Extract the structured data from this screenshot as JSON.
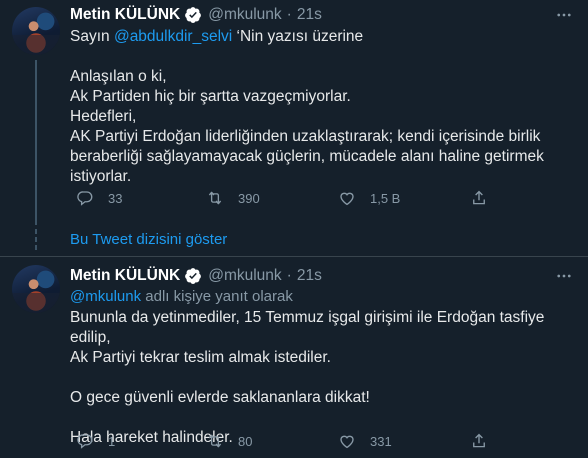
{
  "tweets": [
    {
      "author_name": "Metin KÜLÜNK",
      "handle": "@mkulunk",
      "separator": "·",
      "time": "21s",
      "text_lines": [
        {
          "before": "Sayın ",
          "mention": "@abdulkdir_selvi",
          "after": " ‘Nin yazısı üzerine"
        },
        {
          "text": ""
        },
        {
          "text": "Anlaşılan o ki,"
        },
        {
          "text": "Ak Partiden hiç bir şartta vazgeçmiyorlar."
        },
        {
          "text": "Hedefleri,"
        },
        {
          "text": "AK Partiyi Erdoğan liderliğinden uzaklaştırarak; kendi içerisinde birlik"
        },
        {
          "text": "beraberliği sağlayamayacak güçlerin, mücadele alanı haline getirmek"
        },
        {
          "text": "istiyorlar."
        }
      ],
      "replies": "33",
      "retweets": "390",
      "likes": "1,5 B"
    },
    {
      "author_name": "Metin KÜLÜNK",
      "handle": "@mkulunk",
      "separator": "·",
      "time": "21s",
      "reply_to_mention": "@mkulunk",
      "reply_to_suffix": " adlı kişiye yanıt olarak",
      "text_lines": [
        {
          "text": "Bununla da yetinmediler, 15 Temmuz işgal girişimi ile Erdoğan tasfiye edilip,"
        },
        {
          "text": "Ak Partiyi tekrar teslim almak istediler."
        },
        {
          "text": ""
        },
        {
          "text": "O gece güvenli evlerde saklananlara dikkat!"
        },
        {
          "text": ""
        },
        {
          "text": "Hala hareket halindeler."
        }
      ],
      "replies": "1",
      "retweets": "80",
      "likes": "331"
    }
  ],
  "thread_link_label": "Bu Tweet dizisini göster",
  "icons": {
    "verified": "verified-badge-icon",
    "more": "more-options-icon",
    "reply": "reply-icon",
    "retweet": "retweet-icon",
    "like": "heart-icon",
    "share": "share-icon"
  },
  "colors": {
    "background": "#15202b",
    "link": "#1d9bf0",
    "muted": "#8899a6",
    "text": "#e7e9ea",
    "divider": "#38444d"
  }
}
